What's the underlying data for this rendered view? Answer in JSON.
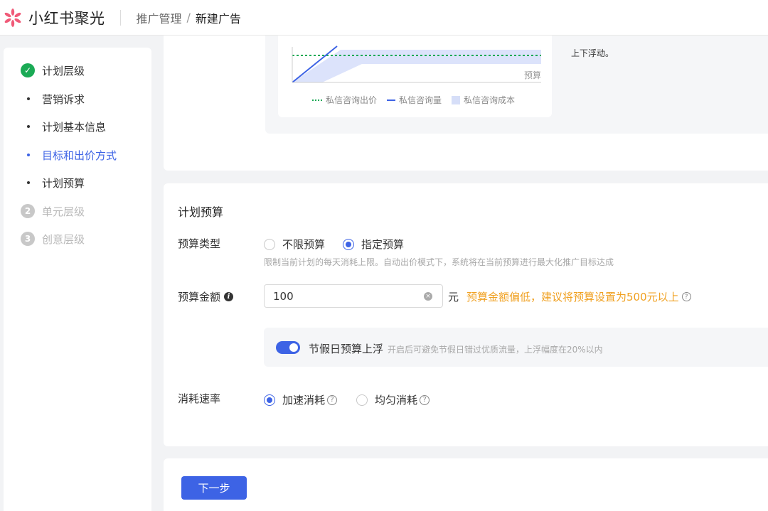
{
  "header": {
    "brand": "小红书聚光",
    "breadcrumb": {
      "parent": "推广管理",
      "separator": "/",
      "current": "新建广告"
    }
  },
  "sidebar": {
    "items": [
      {
        "label": "计划层级",
        "badge": "✓",
        "state": "done"
      },
      {
        "label": "营销诉求",
        "state": "sub"
      },
      {
        "label": "计划基本信息",
        "state": "sub"
      },
      {
        "label": "目标和出价方式",
        "state": "active"
      },
      {
        "label": "计划预算",
        "state": "sub"
      },
      {
        "label": "单元层级",
        "badge": "2",
        "state": "disabled"
      },
      {
        "label": "创意层级",
        "badge": "3",
        "state": "disabled"
      }
    ]
  },
  "chart": {
    "axis_x_label": "预算",
    "note": "上下浮动。",
    "legend": [
      {
        "label": "私信咨询出价",
        "color": "#1aaa55",
        "style": "dotted"
      },
      {
        "label": "私信咨询量",
        "color": "#3d63e5",
        "style": "solid"
      },
      {
        "label": "私信咨询成本",
        "color": "#d6def8",
        "style": "area"
      }
    ]
  },
  "budget": {
    "title": "计划预算",
    "type_label": "预算类型",
    "type_options": [
      {
        "label": "不限预算",
        "checked": false
      },
      {
        "label": "指定预算",
        "checked": true
      }
    ],
    "type_hint": "限制当前计划的每天消耗上限。自动出价模式下，系统将在当前预算进行最大化推广目标达成",
    "amount_label": "预算金额",
    "amount_info_icon": "i",
    "amount_value": "100",
    "amount_clear_icon": "×",
    "amount_unit": "元",
    "amount_warning": "预算金额偏低，建议将预算设置为500元以上",
    "help_glyph": "?",
    "holiday_toggle_on": true,
    "holiday_label": "节假日预算上浮",
    "holiday_hint": "开启后可避免节假日错过优质流量，上浮幅度在20%以内",
    "rate_label": "消耗速率",
    "rate_options": [
      {
        "label": "加速消耗",
        "checked": true
      },
      {
        "label": "均匀消耗",
        "checked": false
      }
    ]
  },
  "footer": {
    "next_label": "下一步"
  }
}
